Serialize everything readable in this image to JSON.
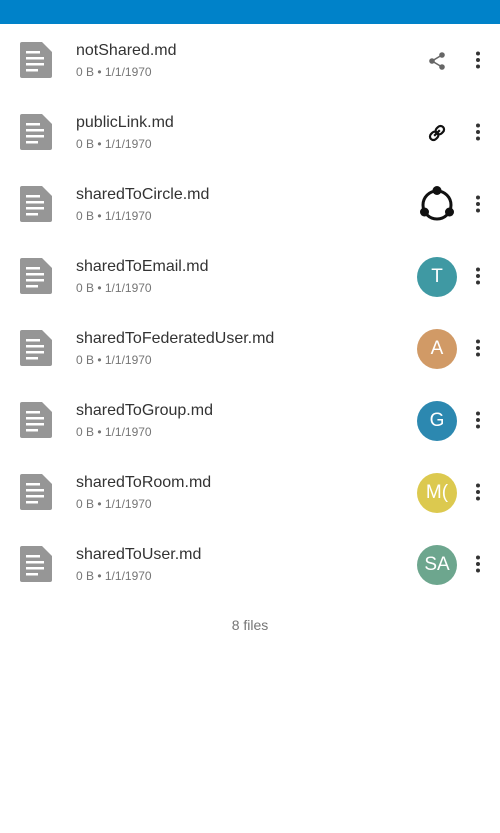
{
  "app": {
    "accent_color": "#0082c9"
  },
  "files": [
    {
      "name": "notShared.md",
      "meta": "0 B • 1/1/1970",
      "share_type": "share-icon"
    },
    {
      "name": "publicLink.md",
      "meta": "0 B • 1/1/1970",
      "share_type": "link-icon"
    },
    {
      "name": "sharedToCircle.md",
      "meta": "0 B • 1/1/1970",
      "share_type": "circle-icon"
    },
    {
      "name": "sharedToEmail.md",
      "meta": "0 B • 1/1/1970",
      "share_type": "avatar",
      "avatar_text": "T",
      "avatar_color": "#3f99a3"
    },
    {
      "name": "sharedToFederatedUser.md",
      "meta": "0 B • 1/1/1970",
      "share_type": "avatar",
      "avatar_text": "A",
      "avatar_color": "#d19a66"
    },
    {
      "name": "sharedToGroup.md",
      "meta": "0 B • 1/1/1970",
      "share_type": "avatar",
      "avatar_text": "G",
      "avatar_color": "#2c88b0"
    },
    {
      "name": "sharedToRoom.md",
      "meta": "0 B • 1/1/1970",
      "share_type": "avatar",
      "avatar_text": "M(",
      "avatar_color": "#dcc94f"
    },
    {
      "name": "sharedToUser.md",
      "meta": "0 B • 1/1/1970",
      "share_type": "avatar",
      "avatar_text": "SA",
      "avatar_color": "#6da68e"
    }
  ],
  "footer": {
    "count_label": "8 files"
  }
}
